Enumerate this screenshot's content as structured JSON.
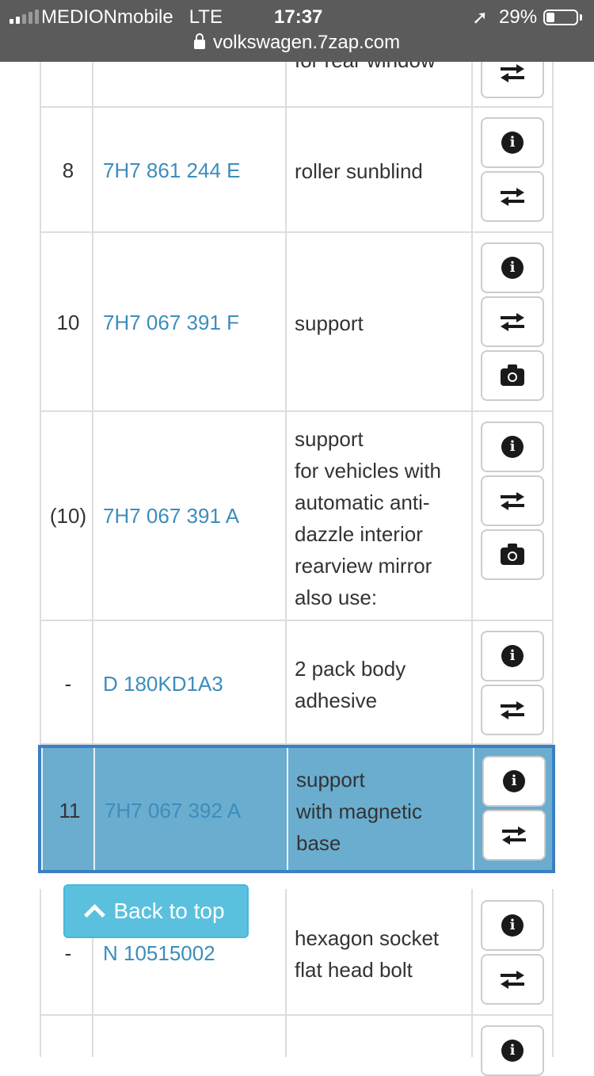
{
  "status_bar": {
    "carrier": "MEDIONmobile",
    "network": "LTE",
    "time": "17:37",
    "battery": "29%",
    "battery_level": 0.29
  },
  "browser": {
    "url": "volkswagen.7zap.com"
  },
  "rows": [
    {
      "num": "",
      "part": "",
      "desc": [
        "for rear window"
      ],
      "buttons": [
        "swap-icon"
      ]
    },
    {
      "num": "8",
      "part": "7H7 861 244 E",
      "desc": [
        "roller sunblind"
      ],
      "buttons": [
        "info-icon",
        "swap-icon"
      ]
    },
    {
      "num": "10",
      "part": "7H7 067 391 F",
      "desc": [
        "support"
      ],
      "buttons": [
        "info-icon",
        "swap-icon",
        "camera-icon"
      ]
    },
    {
      "num": "(10)",
      "part": "7H7 067 391 A",
      "desc": [
        "support",
        "for vehicles with",
        "automatic anti-",
        "dazzle interior",
        "rearview mirror",
        "also use:"
      ],
      "buttons": [
        "info-icon",
        "swap-icon",
        "camera-icon"
      ]
    },
    {
      "num": "-",
      "part": "D  180KD1A3",
      "desc": [
        "2 pack body",
        "adhesive"
      ],
      "buttons": [
        "info-icon",
        "swap-icon"
      ]
    },
    {
      "num": "11",
      "part": "7H7 067 392 A",
      "desc": [
        "support",
        "with magnetic",
        "base"
      ],
      "buttons": [
        "info-icon",
        "swap-icon"
      ],
      "highlighted": true
    },
    {
      "num": "-",
      "part": "N  10515002",
      "desc": [
        "hexagon socket",
        "flat head bolt"
      ],
      "buttons": [
        "info-icon",
        "swap-icon"
      ]
    },
    {
      "num": "",
      "part": "",
      "desc": [],
      "buttons": [
        "info-icon"
      ]
    }
  ],
  "back_to_top": {
    "label": "Back to top"
  }
}
